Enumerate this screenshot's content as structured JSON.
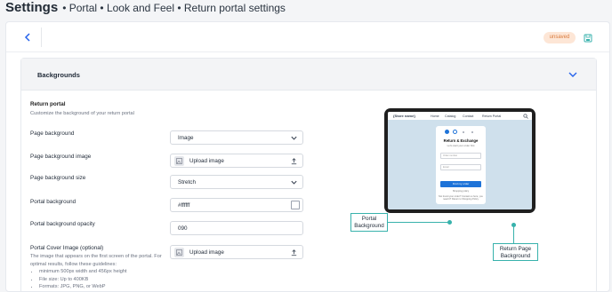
{
  "breadcrumb": {
    "title": "Settings",
    "path": "• Portal • Look and Feel • Return portal settings"
  },
  "topbar": {
    "status_badge": "unsaved"
  },
  "section": {
    "title": "Backgrounds",
    "subtitle": "Return portal",
    "description": "Customize the background of your return portal"
  },
  "fields": {
    "page_background": {
      "label": "Page background",
      "value": "Image"
    },
    "page_background_image": {
      "label": "Page background image",
      "value": "Upload image"
    },
    "page_background_size": {
      "label": "Page background size",
      "value": "Stretch"
    },
    "portal_background": {
      "label": "Portal background",
      "value": "#ffffff"
    },
    "portal_background_opacity": {
      "label": "Portal background opacity",
      "value": "090"
    },
    "portal_cover_image": {
      "label": "Portal Cover Image (optional)",
      "value": "Upload image",
      "guide": "The image that appears on the first screen of the portal. For optimal results, follow these guidelines:",
      "guidelines": [
        "minimum 500px width and 456px height",
        "File size: Up to 400KB",
        "Formats: JPG, PNG, or WebP"
      ]
    }
  },
  "preview": {
    "store_name": "{Store name}",
    "nav_links": [
      "Home",
      "Catalog",
      "Contact",
      "Return Portal"
    ],
    "modal_title": "Return & Exchange",
    "modal_subtitle": "Let's start your order first",
    "input_order": "Order number",
    "input_email": "Email",
    "button": "Find my order",
    "link": "Shopping policy",
    "note": "Not found your order? Contact us here, you need it? Return to Shopping Policy",
    "callout_portal": "Portal\nBackground",
    "callout_page": "Return Page\nBackground"
  },
  "colors": {
    "accent": "#2563eb",
    "teal": "#38b2ac",
    "badge_bg": "#fde6d6",
    "badge_text": "#d97a3c"
  }
}
